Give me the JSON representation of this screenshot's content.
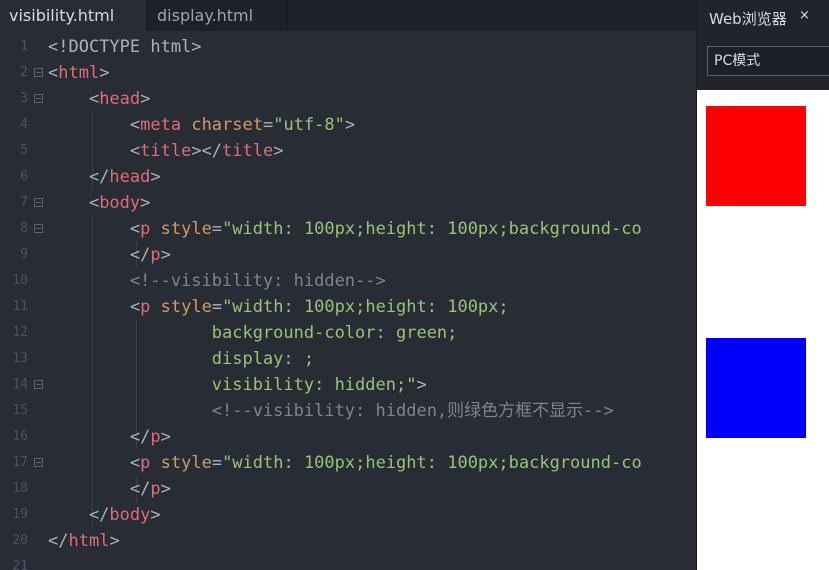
{
  "tabs": [
    {
      "label": "visibility.html",
      "active": true
    },
    {
      "label": "display.html",
      "active": false
    }
  ],
  "line_numbers": [
    "1",
    "2",
    "3",
    "4",
    "5",
    "6",
    "7",
    "8",
    "9",
    "10",
    "11",
    "12",
    "13",
    "14",
    "15",
    "16",
    "17",
    "18",
    "19",
    "20",
    "21"
  ],
  "code_lines": [
    [
      {
        "t": "<!DOCTYPE html>",
        "c": "text"
      }
    ],
    [
      {
        "t": "<",
        "c": "text"
      },
      {
        "t": "html",
        "c": "tag"
      },
      {
        "t": ">",
        "c": "text"
      }
    ],
    [
      {
        "t": "    <",
        "c": "text"
      },
      {
        "t": "head",
        "c": "tag"
      },
      {
        "t": ">",
        "c": "text"
      }
    ],
    [
      {
        "t": "        <",
        "c": "text"
      },
      {
        "t": "meta",
        "c": "tag"
      },
      {
        "t": " ",
        "c": "text"
      },
      {
        "t": "charset",
        "c": "attr"
      },
      {
        "t": "=",
        "c": "text"
      },
      {
        "t": "\"utf-8\"",
        "c": "str"
      },
      {
        "t": ">",
        "c": "text"
      }
    ],
    [
      {
        "t": "        <",
        "c": "text"
      },
      {
        "t": "title",
        "c": "tag"
      },
      {
        "t": "></",
        "c": "text"
      },
      {
        "t": "title",
        "c": "tag"
      },
      {
        "t": ">",
        "c": "text"
      }
    ],
    [
      {
        "t": "    </",
        "c": "text"
      },
      {
        "t": "head",
        "c": "tag"
      },
      {
        "t": ">",
        "c": "text"
      }
    ],
    [
      {
        "t": "    <",
        "c": "text"
      },
      {
        "t": "body",
        "c": "tag"
      },
      {
        "t": ">",
        "c": "text"
      }
    ],
    [
      {
        "t": "        <",
        "c": "text"
      },
      {
        "t": "p",
        "c": "tag"
      },
      {
        "t": " ",
        "c": "text"
      },
      {
        "t": "style",
        "c": "attr"
      },
      {
        "t": "=",
        "c": "text"
      },
      {
        "t": "\"width: 100px;height: 100px;background-co",
        "c": "str"
      }
    ],
    [
      {
        "t": "        </",
        "c": "text"
      },
      {
        "t": "p",
        "c": "tag"
      },
      {
        "t": ">",
        "c": "text"
      }
    ],
    [
      {
        "t": "        <!--visibility: hidden-->",
        "c": "cmt"
      }
    ],
    [
      {
        "t": "        <",
        "c": "text"
      },
      {
        "t": "p",
        "c": "tag"
      },
      {
        "t": " ",
        "c": "text"
      },
      {
        "t": "style",
        "c": "attr"
      },
      {
        "t": "=",
        "c": "text"
      },
      {
        "t": "\"width: 100px;height: 100px;",
        "c": "str"
      }
    ],
    [
      {
        "t": "                background-color: green;",
        "c": "str"
      }
    ],
    [
      {
        "t": "                display: ;",
        "c": "str"
      }
    ],
    [
      {
        "t": "                visibility: hidden;\"",
        "c": "str"
      },
      {
        "t": ">",
        "c": "text"
      }
    ],
    [
      {
        "t": "                <!--visibility: hidden,则绿色方框不显示-->",
        "c": "cmt"
      }
    ],
    [
      {
        "t": "        </",
        "c": "text"
      },
      {
        "t": "p",
        "c": "tag"
      },
      {
        "t": ">",
        "c": "text"
      }
    ],
    [
      {
        "t": "        <",
        "c": "text"
      },
      {
        "t": "p",
        "c": "tag"
      },
      {
        "t": " ",
        "c": "text"
      },
      {
        "t": "style",
        "c": "attr"
      },
      {
        "t": "=",
        "c": "text"
      },
      {
        "t": "\"width: 100px;height: 100px;background-co",
        "c": "str"
      }
    ],
    [
      {
        "t": "        </",
        "c": "text"
      },
      {
        "t": "p",
        "c": "tag"
      },
      {
        "t": ">",
        "c": "text"
      }
    ],
    [
      {
        "t": "    </",
        "c": "text"
      },
      {
        "t": "body",
        "c": "tag"
      },
      {
        "t": ">",
        "c": "text"
      }
    ],
    [
      {
        "t": "</",
        "c": "text"
      },
      {
        "t": "html",
        "c": "tag"
      },
      {
        "t": ">",
        "c": "text"
      }
    ],
    []
  ],
  "browser": {
    "title": "Web浏览器",
    "close_glyph": "×",
    "mode": "PC模式",
    "boxes": [
      {
        "color": "#ff0000"
      },
      {
        "color": "#0000ff"
      }
    ]
  }
}
